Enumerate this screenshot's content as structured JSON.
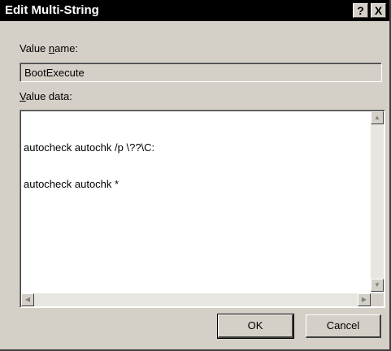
{
  "window": {
    "title": "Edit Multi-String",
    "help_glyph": "?",
    "close_glyph": "X"
  },
  "value_name": {
    "label_prefix": "Value ",
    "label_accel": "n",
    "label_rest": "ame:",
    "value": "BootExecute"
  },
  "value_data": {
    "label_accel": "V",
    "label_rest": "alue data:",
    "lines": [
      "autocheck autochk /p \\??\\C:",
      "autocheck autochk *"
    ]
  },
  "buttons": {
    "ok": "OK",
    "cancel": "Cancel"
  },
  "colors": {
    "face": "#d4d0c8",
    "titlebar": "#000000"
  }
}
